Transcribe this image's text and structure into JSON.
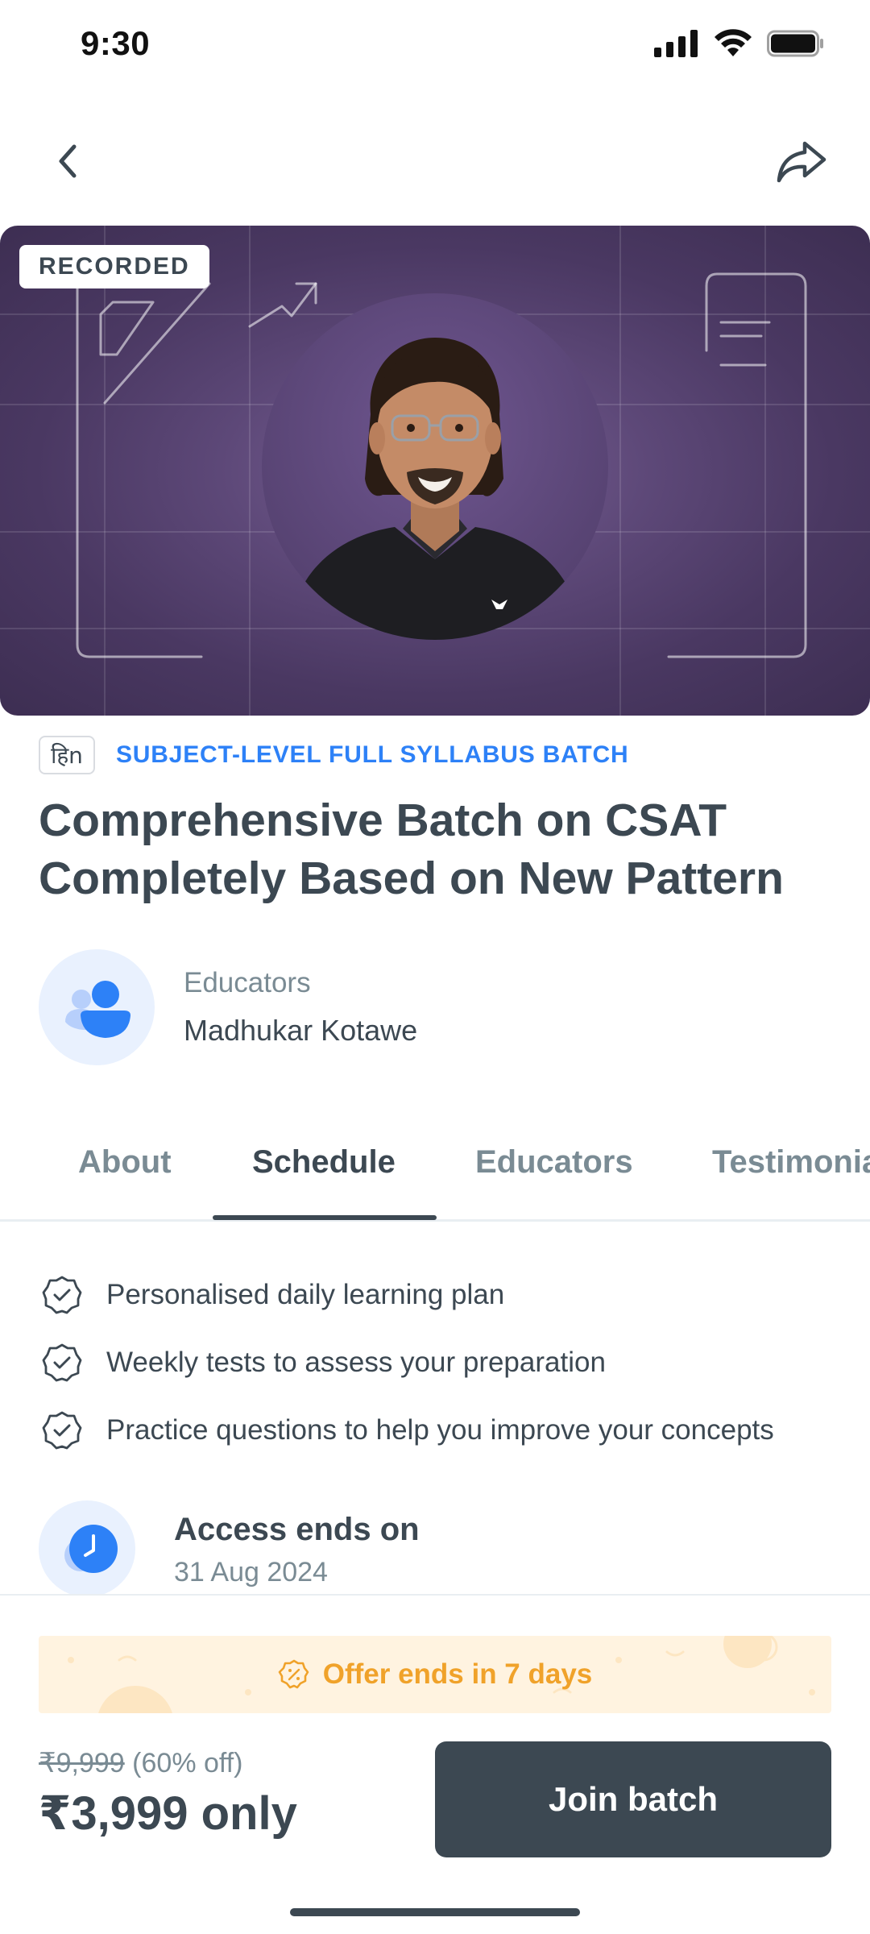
{
  "status_bar": {
    "time": "9:30"
  },
  "nav": {
    "back_icon": "chevron-left-icon",
    "share_icon": "share-icon"
  },
  "hero": {
    "badge": "RECORDED"
  },
  "batch": {
    "language_badge": "हिn",
    "type_label": "SUBJECT-LEVEL FULL SYLLABUS BATCH",
    "title_line1": "Comprehensive Batch on CSAT",
    "title_line2": "Completely Based on New Pattern"
  },
  "educators": {
    "label": "Educators",
    "name": "Madhukar Kotawe"
  },
  "tabs": [
    {
      "label": "About"
    },
    {
      "label": "Schedule",
      "active": true
    },
    {
      "label": "Educators"
    },
    {
      "label": "Testimonials"
    }
  ],
  "features": [
    {
      "text": "Personalised daily learning plan"
    },
    {
      "text": "Weekly tests to assess your preparation"
    },
    {
      "text": "Practice questions to help you improve your concepts"
    }
  ],
  "access": {
    "title": "Access ends on",
    "date": "31 Aug 2024"
  },
  "offer": {
    "text": "Offer ends in 7 days"
  },
  "pricing": {
    "old_price": "₹9,999",
    "discount": "(60% off)",
    "price": "₹3,999 only"
  },
  "cta": {
    "label": "Join batch"
  },
  "colors": {
    "accent_blue": "#2d81f7",
    "offer_orange": "#f0a22a",
    "dark": "#3c4852",
    "hero_purple": "#4a3862"
  }
}
